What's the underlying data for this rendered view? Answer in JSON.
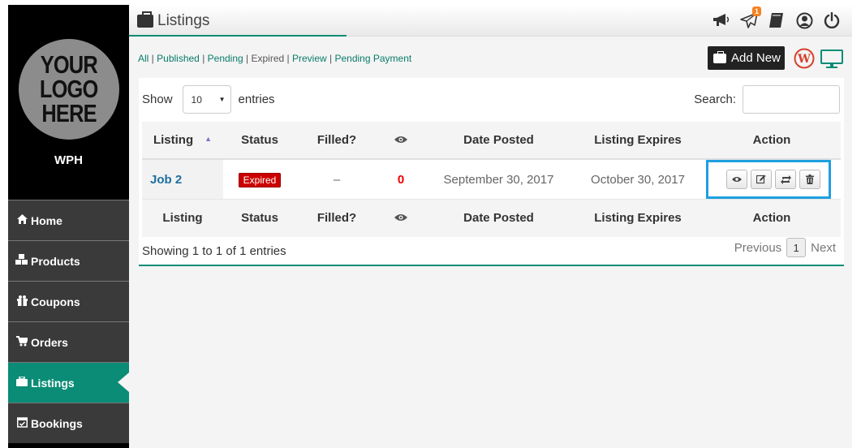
{
  "brand": {
    "logo_text": [
      "YOUR",
      "LOGO",
      "HERE"
    ],
    "site_name": "WPH"
  },
  "sidebar": {
    "items": [
      {
        "label": "Home",
        "icon": "home-icon"
      },
      {
        "label": "Products",
        "icon": "cubes-icon"
      },
      {
        "label": "Coupons",
        "icon": "gift-icon"
      },
      {
        "label": "Orders",
        "icon": "cart-icon"
      },
      {
        "label": "Listings",
        "icon": "briefcase-icon",
        "active": true
      },
      {
        "label": "Bookings",
        "icon": "calendar-check-icon"
      }
    ]
  },
  "header": {
    "title": "Listings",
    "notification_count": "1",
    "icons": [
      "megaphone-icon",
      "paper-plane-icon",
      "book-icon",
      "user-circle-icon",
      "power-icon"
    ]
  },
  "filters": {
    "all": "All",
    "published": "Published",
    "pending": "Pending",
    "expired": "Expired",
    "preview": "Preview",
    "pending_payment": "Pending Payment"
  },
  "toolbar": {
    "add_new_label": "Add New"
  },
  "table_controls": {
    "show_label": "Show",
    "entries_value": "10",
    "entries_label": "entries",
    "search_label": "Search:",
    "search_value": ""
  },
  "table": {
    "columns": [
      "Listing",
      "Status",
      "Filled?",
      "eye-icon",
      "Date Posted",
      "Listing Expires",
      "Action"
    ],
    "rows": [
      {
        "listing": "Job 2",
        "status": "Expired",
        "filled": "–",
        "views": "0",
        "date_posted": "September 30, 2017",
        "expires": "October 30, 2017",
        "actions": [
          "view-icon",
          "edit-icon",
          "relist-icon",
          "delete-icon"
        ]
      }
    ]
  },
  "footer": {
    "info": "Showing 1 to 1 of 1 entries",
    "previous": "Previous",
    "page": "1",
    "next": "Next"
  },
  "colors": {
    "accent": "#0a8c76",
    "highlight_box": "#1e9fe0",
    "status_expired": "#cc0000",
    "notification": "#f58220"
  }
}
